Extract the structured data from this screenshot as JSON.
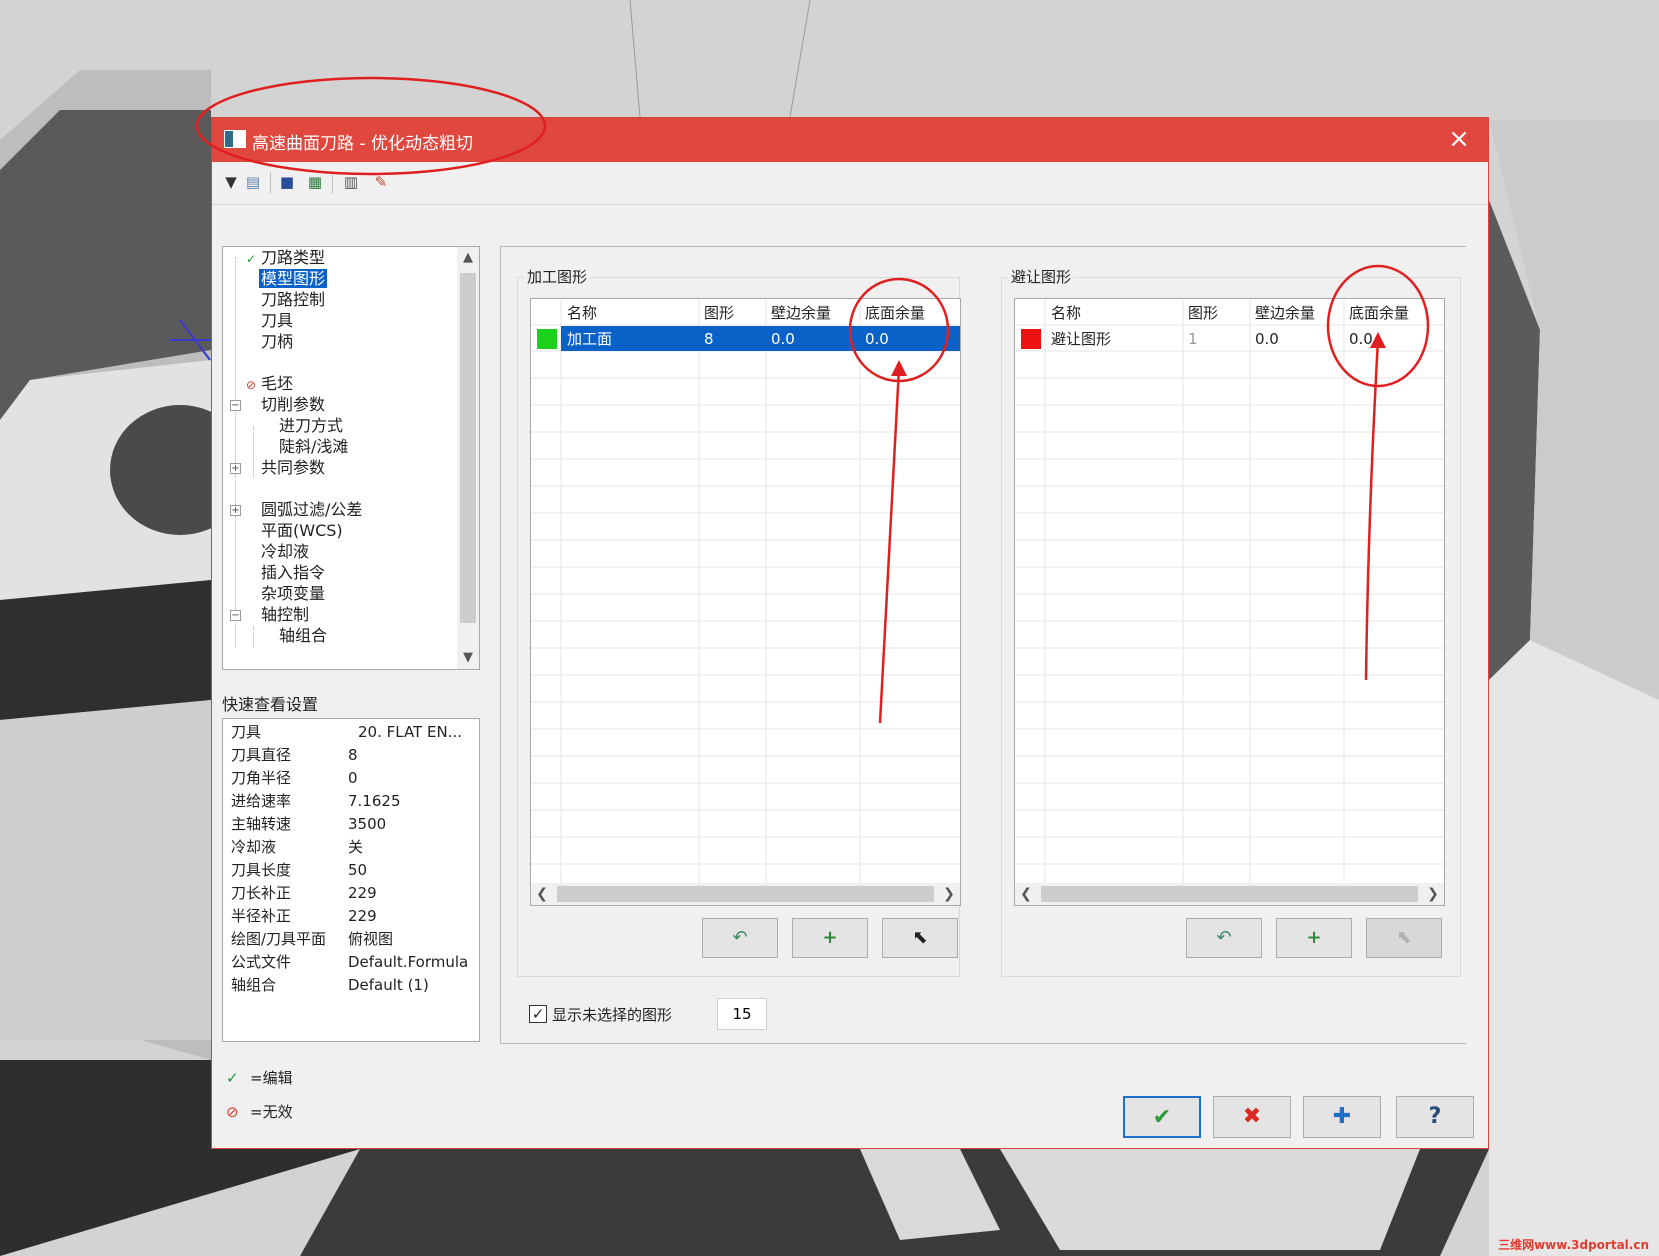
{
  "window": {
    "title": "高速曲面刀路 - 优化动态粗切",
    "close_icon": "×"
  },
  "toolbar": {
    "icons": [
      "tool-icon",
      "copy-params-icon",
      "save-icon",
      "export-icon",
      "calculator-icon",
      "cancel-edit-icon"
    ]
  },
  "tree": {
    "items": [
      {
        "label": "刀路类型",
        "mark": "✓"
      },
      {
        "label": "模型图形",
        "mark": ""
      },
      {
        "label": "刀路控制",
        "mark": ""
      },
      {
        "label": "刀具",
        "mark": ""
      },
      {
        "label": "刀柄",
        "mark": ""
      },
      {
        "label": "毛坯",
        "mark": "⊘"
      },
      {
        "label": "切削参数",
        "mark": ""
      },
      {
        "label": "进刀方式",
        "mark": ""
      },
      {
        "label": "陡斜/浅滩",
        "mark": ""
      },
      {
        "label": "共同参数",
        "mark": ""
      },
      {
        "label": "圆弧过滤/公差",
        "mark": ""
      },
      {
        "label": "平面(WCS)",
        "mark": ""
      },
      {
        "label": "冷却液",
        "mark": ""
      },
      {
        "label": "插入指令",
        "mark": ""
      },
      {
        "label": "杂项变量",
        "mark": ""
      },
      {
        "label": "轴控制",
        "mark": ""
      },
      {
        "label": "轴组合",
        "mark": ""
      }
    ],
    "expanders": [
      "−",
      "+",
      "+",
      "−"
    ]
  },
  "quick_view": {
    "title": "快速查看设置",
    "rows": [
      {
        "k": "刀具",
        "v": "20. FLAT EN..."
      },
      {
        "k": "刀具直径",
        "v": "8"
      },
      {
        "k": "刀角半径",
        "v": "0"
      },
      {
        "k": "进给速率",
        "v": "7.1625"
      },
      {
        "k": "主轴转速",
        "v": "3500"
      },
      {
        "k": "冷却液",
        "v": "关"
      },
      {
        "k": "刀具长度",
        "v": "50"
      },
      {
        "k": "刀长补正",
        "v": "229"
      },
      {
        "k": "半径补正",
        "v": "229"
      },
      {
        "k": "绘图/刀具平面",
        "v": "俯视图"
      },
      {
        "k": "公式文件",
        "v": "Default.Formula"
      },
      {
        "k": "轴组合",
        "v": "Default (1)"
      }
    ]
  },
  "legend": [
    {
      "sym": "✓",
      "text": "=编辑",
      "color": "#1a9c2f"
    },
    {
      "sym": "⊘",
      "text": "=无效",
      "color": "#d23a2c"
    }
  ],
  "machining": {
    "title": "加工图形",
    "headers": [
      "名称",
      "图形",
      "壁边余量",
      "底面余量"
    ],
    "rows": [
      {
        "color": "#19d219",
        "name": "加工面",
        "count": "8",
        "wall": "0.0",
        "floor": "0.0"
      }
    ]
  },
  "avoidance": {
    "title": "避让图形",
    "headers": [
      "名称",
      "图形",
      "壁边余量",
      "底面余量"
    ],
    "rows": [
      {
        "color": "#ee1111",
        "name": "避让图形",
        "count": "1",
        "wall": "0.0",
        "floor": "0.0"
      }
    ]
  },
  "group_buttons": {
    "undo": "↶",
    "add": "+",
    "select": "⬉"
  },
  "show_unselected": {
    "label": "显示未选择的图形",
    "checked": "✓",
    "value": "15"
  },
  "dialog_buttons": {
    "ok": "✔",
    "cancel": "✖",
    "apply": "✚",
    "help": "?"
  },
  "colors": {
    "title_bar": "#e0483f",
    "selection": "#0a62c8",
    "annotation": "#e02020"
  },
  "watermark": "三维网www.3dportal.cn"
}
